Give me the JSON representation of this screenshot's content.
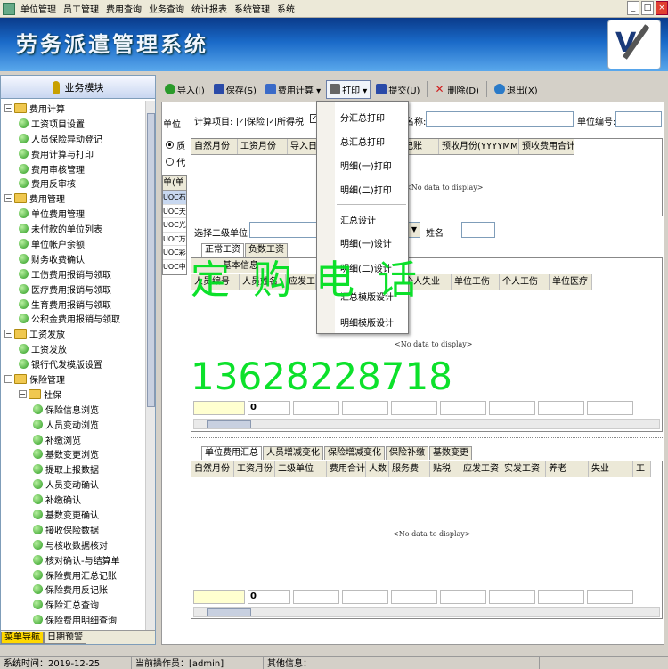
{
  "menu": [
    "单位管理",
    "员工管理",
    "费用查询",
    "业务查询",
    "统计报表",
    "系统管理",
    "系统"
  ],
  "app_title": "劳务派遣管理系统",
  "left_panel": {
    "title": "业务模块",
    "tree": [
      {
        "level": 0,
        "type": "folder",
        "label": "费用计算"
      },
      {
        "level": 1,
        "type": "item",
        "label": "工资项目设置"
      },
      {
        "level": 1,
        "type": "item",
        "label": "人员保险异动登记"
      },
      {
        "level": 1,
        "type": "item",
        "label": "费用计算与打印"
      },
      {
        "level": 1,
        "type": "item",
        "label": "费用审核管理"
      },
      {
        "level": 1,
        "type": "item",
        "label": "费用反审核"
      },
      {
        "level": 0,
        "type": "folder",
        "label": "费用管理"
      },
      {
        "level": 1,
        "type": "item",
        "label": "单位费用管理"
      },
      {
        "level": 1,
        "type": "item",
        "label": "未付款的单位列表"
      },
      {
        "level": 1,
        "type": "item",
        "label": "单位帐户余额"
      },
      {
        "level": 1,
        "type": "item",
        "label": "财务收费确认"
      },
      {
        "level": 1,
        "type": "item",
        "label": "工伤费用报销与领取"
      },
      {
        "level": 1,
        "type": "item",
        "label": "医疗费用报销与领取"
      },
      {
        "level": 1,
        "type": "item",
        "label": "生育费用报销与领取"
      },
      {
        "level": 1,
        "type": "item",
        "label": "公积金费用报销与领取"
      },
      {
        "level": 0,
        "type": "folder",
        "label": "工资发放"
      },
      {
        "level": 1,
        "type": "item",
        "label": "工资发放"
      },
      {
        "level": 1,
        "type": "item",
        "label": "银行代发模版设置"
      },
      {
        "level": 0,
        "type": "folder",
        "label": "保险管理"
      },
      {
        "level": 1,
        "type": "folder",
        "label": "社保"
      },
      {
        "level": 2,
        "type": "item",
        "label": "保险信息浏览"
      },
      {
        "level": 2,
        "type": "item",
        "label": "人员变动浏览"
      },
      {
        "level": 2,
        "type": "item",
        "label": "补缴浏览"
      },
      {
        "level": 2,
        "type": "item",
        "label": "基数变更浏览"
      },
      {
        "level": 2,
        "type": "item",
        "label": "提取上报数据"
      },
      {
        "level": 2,
        "type": "item",
        "label": "人员变动确认"
      },
      {
        "level": 2,
        "type": "item",
        "label": "补缴确认"
      },
      {
        "level": 2,
        "type": "item",
        "label": "基数变更确认"
      },
      {
        "level": 2,
        "type": "item",
        "label": "接收保险数据"
      },
      {
        "level": 2,
        "type": "item",
        "label": "与核收数据核对"
      },
      {
        "level": 2,
        "type": "item",
        "label": "核对确认-与结算单"
      },
      {
        "level": 2,
        "type": "item",
        "label": "保险费用汇总记账"
      },
      {
        "level": 2,
        "type": "item",
        "label": "保险费用反记账"
      },
      {
        "level": 2,
        "type": "item",
        "label": "保险汇总查询"
      },
      {
        "level": 2,
        "type": "item",
        "label": "保险费用明细查询"
      }
    ],
    "tabs": [
      "菜单导航",
      "日期预警"
    ]
  },
  "toolbar": [
    {
      "label": "导入(I)",
      "icon": "import-icon",
      "color": "#2a9a2a"
    },
    {
      "label": "保存(S)",
      "icon": "save-icon",
      "color": "#2a4aa8"
    },
    {
      "label": "费用计算 ▾",
      "icon": "calc-icon",
      "color": "#3a6ac8"
    },
    {
      "label": "打印 ▾",
      "icon": "print-icon",
      "color": "#666666"
    },
    {
      "label": "提交(U)",
      "icon": "submit-icon",
      "color": "#2a4aa8"
    },
    {
      "label": "删除(D)",
      "icon": "delete-icon",
      "color": "#d02020"
    },
    {
      "label": "退出(X)",
      "icon": "exit-icon",
      "color": "#2a7ac8"
    }
  ],
  "filters": {
    "unit_label_partial": "单位",
    "calc_items_label": "计算项目:",
    "checks": [
      "保险",
      "所得税"
    ],
    "name_label": "名称:",
    "unit_no_label": "单位编号:",
    "radio_a": "质",
    "radio_b": "代"
  },
  "top_grid": {
    "columns": [
      "自然月份",
      "工资月份",
      "导入日",
      "是否提交",
      "是否记账",
      "预收月份(YYYYMM-YYYYMM)",
      "预收费用合计"
    ],
    "empty_text": "<No data to display>",
    "left_codes": [
      "UOC",
      "UOC",
      "UOC",
      "UOC",
      "UOC",
      "UOC"
    ],
    "left_suffix": [
      "石",
      "天",
      "光",
      "万",
      "彩",
      "中"
    ],
    "left_header": "单(单"
  },
  "second_unit_label": "选择二级单位",
  "name2_label": "姓名",
  "mid_tabs": [
    "正常工资",
    "负数工资"
  ],
  "mid_grid": {
    "group_header": "基本信息",
    "columns": [
      "人员编号",
      "人员姓名",
      "应发工",
      "养老",
      "单位失业",
      "个人失业",
      "单位工伤",
      "个人工伤",
      "单位医疗"
    ],
    "empty_text": "<No data to display>",
    "sum_value": "0"
  },
  "bottom_tabs": [
    "单位费用汇总",
    "人员增减变化",
    "保险增减变化",
    "保险补缴",
    "基数变更"
  ],
  "bottom_grid": {
    "columns": [
      "自然月份",
      "工资月份",
      "二级单位",
      "费用合计",
      "人数",
      "服务费",
      "贴税",
      "应发工资",
      "实发工资",
      "养老",
      "失业",
      "工"
    ],
    "empty_text": "<No data to display>",
    "sum_value": "0"
  },
  "print_menu": {
    "items": [
      "分汇总打印",
      "总汇总打印",
      "明细(一)打印",
      "明细(二)打印",
      "汇总设计",
      "明细(一)设计",
      "明细(二)设计",
      "汇总模版设计",
      "明细模版设计"
    ]
  },
  "watermark": {
    "line1": "定 购 电 话",
    "line2": "13628228718"
  },
  "statusbar": [
    "系统时间：2019-12-25",
    "当前操作员：[admin]",
    "其他信息："
  ],
  "colors": {
    "accent": "#1a6ac8",
    "watermark": "#00e020",
    "highlight": "#ffd800"
  }
}
